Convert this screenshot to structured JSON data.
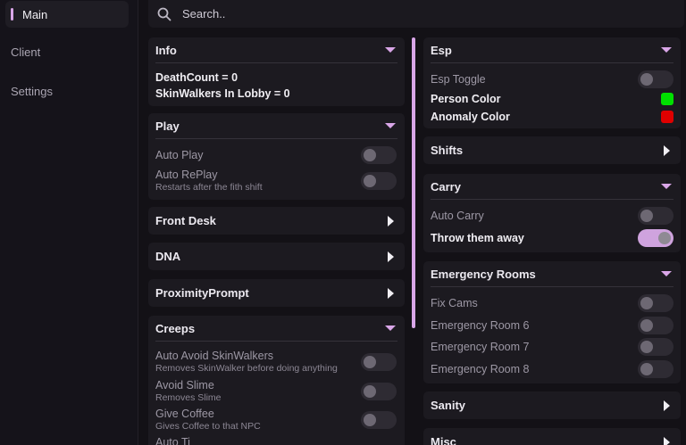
{
  "sidebar": {
    "items": [
      {
        "label": "Main",
        "active": true
      },
      {
        "label": "Client",
        "active": false
      },
      {
        "label": "Settings",
        "active": false
      }
    ]
  },
  "search": {
    "placeholder": "Search.."
  },
  "colors": {
    "accent": "#d9a6e8",
    "person": "#00e000",
    "anomaly": "#e00000"
  },
  "left": {
    "info": {
      "title": "Info",
      "lines": [
        "DeathCount = 0",
        "SkinWalkers In Lobby = 0"
      ]
    },
    "play": {
      "title": "Play",
      "auto_play": {
        "label": "Auto Play",
        "on": false
      },
      "auto_replay": {
        "label": "Auto RePlay",
        "sub": "Restarts after the fith shift",
        "on": false
      }
    },
    "front_desk": {
      "title": "Front Desk"
    },
    "dna": {
      "title": "DNA"
    },
    "proximity": {
      "title": "ProximityPrompt"
    },
    "creeps": {
      "title": "Creeps",
      "items": [
        {
          "label": "Auto Avoid SkinWalkers",
          "sub": "Removes SkinWalker before doing anything",
          "on": false
        },
        {
          "label": "Avoid Slime",
          "sub": "Removes Slime",
          "on": false
        },
        {
          "label": "Give Coffee",
          "sub": "Gives Coffee to that NPC",
          "on": false
        }
      ],
      "cut_label": "Auto Ti"
    }
  },
  "right": {
    "esp": {
      "title": "Esp",
      "toggle": {
        "label": "Esp Toggle",
        "on": false
      },
      "person": {
        "label": "Person Color"
      },
      "anomaly": {
        "label": "Anomaly Color"
      }
    },
    "shifts": {
      "title": "Shifts"
    },
    "carry": {
      "title": "Carry",
      "auto_carry": {
        "label": "Auto Carry",
        "on": false
      },
      "throw": {
        "label": "Throw them away",
        "on": true
      }
    },
    "emergency": {
      "title": "Emergency Rooms",
      "items": [
        {
          "label": "Fix Cams",
          "on": false
        },
        {
          "label": "Emergency Room 6",
          "on": false
        },
        {
          "label": "Emergency Room 7",
          "on": false
        },
        {
          "label": "Emergency Room 8",
          "on": false
        }
      ]
    },
    "sanity": {
      "title": "Sanity"
    },
    "misc": {
      "title": "Misc"
    }
  }
}
